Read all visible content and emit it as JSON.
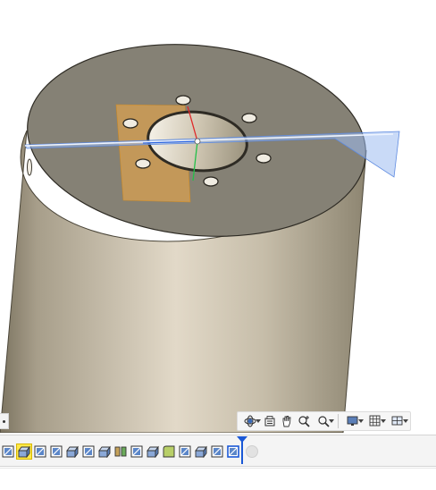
{
  "viewport": {
    "model": "cylinder-with-bolt-pattern",
    "colors": {
      "background": "#ffffff",
      "body_light": "#e2d9c8",
      "body_dark": "#7c7461",
      "top_face": "#858175",
      "construction_plane": "#f5ac42",
      "work_plane": "#9cbcf0",
      "axis_x": "#e02828",
      "axis_y": "#24c04a",
      "axis_z": "#2a64e0"
    }
  },
  "nav_toolbar": {
    "items": [
      {
        "icon": "orbit-icon",
        "has_dropdown": true
      },
      {
        "icon": "look-at-icon",
        "has_dropdown": false
      },
      {
        "icon": "pan-hand-icon",
        "has_dropdown": false
      },
      {
        "icon": "zoom-window-icon",
        "has_dropdown": false
      },
      {
        "icon": "zoom-fit-icon",
        "has_dropdown": true
      },
      {
        "icon": "display-settings-icon",
        "has_dropdown": true
      },
      {
        "icon": "grid-settings-icon",
        "has_dropdown": true
      },
      {
        "icon": "viewports-icon",
        "has_dropdown": true
      }
    ]
  },
  "timeline": {
    "features": [
      {
        "type": "sketch",
        "icon": "sketch-feature-icon",
        "selected": false
      },
      {
        "type": "extrude",
        "icon": "extrude-feature-icon",
        "selected": true
      },
      {
        "type": "sketch",
        "icon": "sketch-feature-icon",
        "selected": false
      },
      {
        "type": "sketch",
        "icon": "sketch-feature-icon",
        "selected": false
      },
      {
        "type": "extrude",
        "icon": "extrude-feature-icon",
        "selected": false
      },
      {
        "type": "sketch",
        "icon": "sketch-feature-icon",
        "selected": false
      },
      {
        "type": "extrude",
        "icon": "extrude-feature-icon",
        "selected": false
      },
      {
        "type": "split",
        "icon": "split-body-icon",
        "selected": false
      },
      {
        "type": "sketch",
        "icon": "sketch-feature-icon",
        "selected": false
      },
      {
        "type": "extrude",
        "icon": "extrude-feature-icon",
        "selected": false
      },
      {
        "type": "fillet",
        "icon": "fillet-feature-icon",
        "selected": false
      },
      {
        "type": "sketch",
        "icon": "sketch-feature-icon",
        "selected": false
      },
      {
        "type": "extrude",
        "icon": "extrude-feature-icon",
        "selected": false
      },
      {
        "type": "sketch",
        "icon": "sketch-feature-icon",
        "selected": false
      },
      {
        "type": "sketch-active",
        "icon": "sketch-active-icon",
        "selected": false
      }
    ],
    "marker_color": "#1a58d6"
  }
}
